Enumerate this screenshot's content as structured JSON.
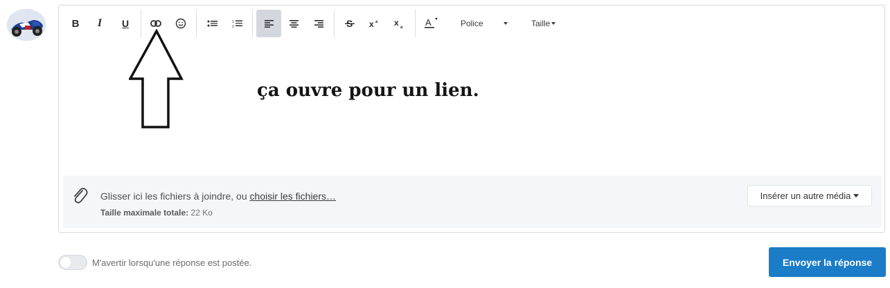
{
  "user": {
    "avatar_icon": "motorcycle-avatar-icon"
  },
  "toolbar": {
    "buttons": [
      {
        "name": "bold",
        "icon": "bold-icon",
        "label": "B"
      },
      {
        "name": "italic",
        "icon": "italic-icon",
        "label": "I"
      },
      {
        "name": "underline",
        "icon": "underline-icon",
        "label": "U"
      },
      {
        "name": "link",
        "icon": "link-icon"
      },
      {
        "name": "emoji",
        "icon": "smiley-icon"
      },
      {
        "name": "bullet-list",
        "icon": "bullet-list-icon"
      },
      {
        "name": "numbered-list",
        "icon": "numbered-list-icon"
      },
      {
        "name": "align-left",
        "icon": "align-left-icon",
        "active": true
      },
      {
        "name": "align-center",
        "icon": "align-center-icon"
      },
      {
        "name": "align-right",
        "icon": "align-right-icon"
      },
      {
        "name": "strikethrough",
        "icon": "strikethrough-icon"
      },
      {
        "name": "superscript",
        "icon": "superscript-icon"
      },
      {
        "name": "subscript",
        "icon": "subscript-icon"
      },
      {
        "name": "text-color",
        "icon": "text-color-icon"
      }
    ],
    "font_label": "Police",
    "size_label": "Taille",
    "active_color": "#d4d8de"
  },
  "editor": {
    "content": "ça ouvre pour un lien.",
    "annotation_icon": "arrow-up-icon"
  },
  "attachments": {
    "icon": "paperclip-icon",
    "drop_text": "Glisser ici les fichiers à joindre, ou ",
    "choose_link": "choisir les fichiers…",
    "max_label": "Taille maximale totale:",
    "max_value": "22 Ko",
    "insert_media_label": "Insérer un autre média"
  },
  "footer": {
    "notify_label": "M'avertir lorsqu'une réponse est postée.",
    "notify_enabled": false,
    "submit_label": "Envoyer la réponse",
    "submit_color": "#1b7cc8"
  }
}
